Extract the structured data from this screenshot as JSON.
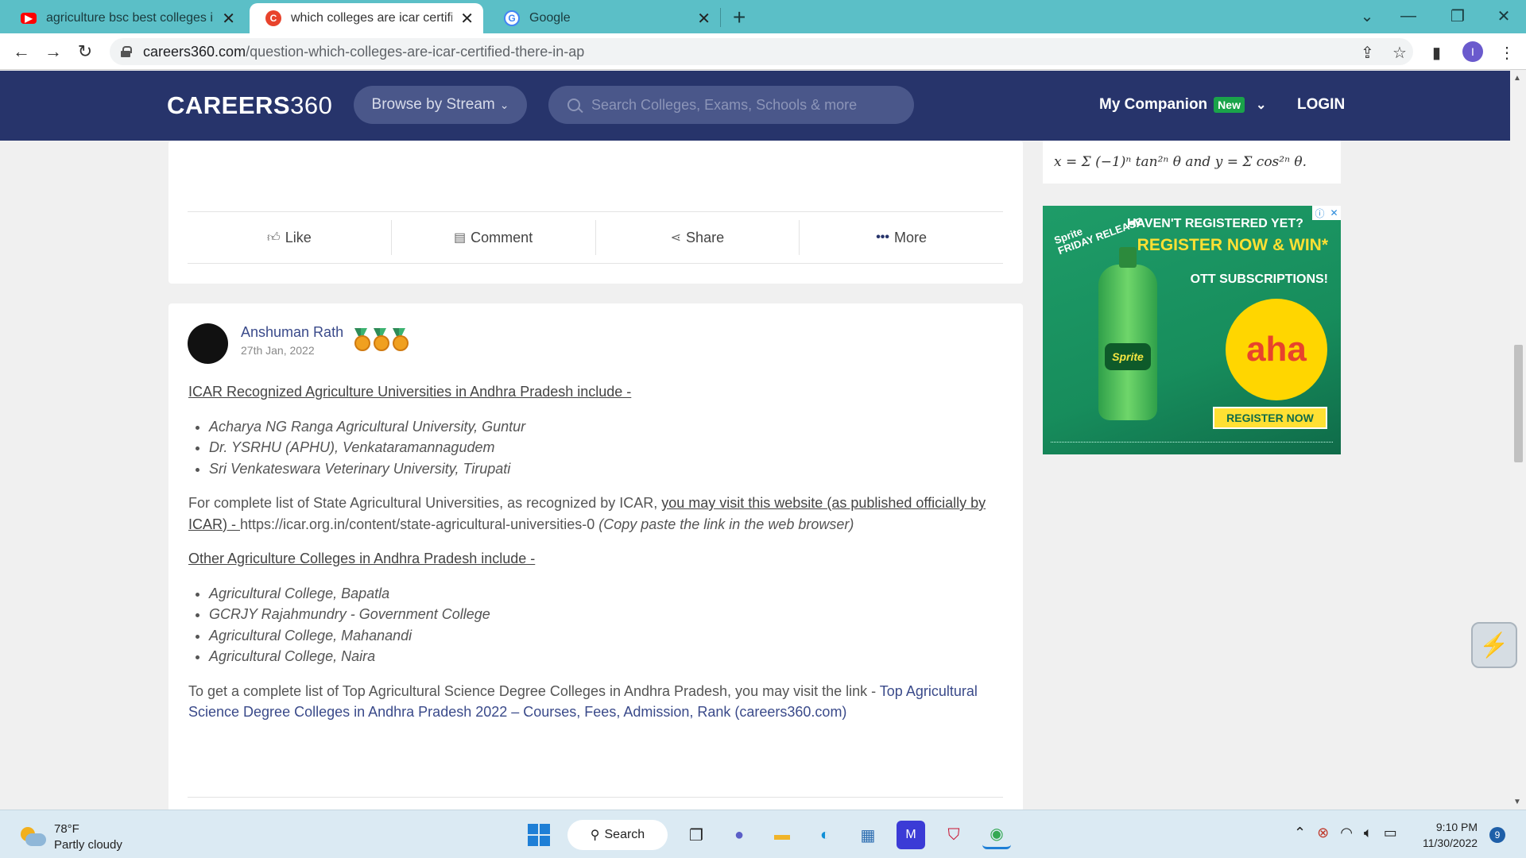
{
  "browser": {
    "tabs": [
      {
        "title": "agriculture bsc best colleges in a",
        "favicon": "youtube-icon",
        "color": "#ff0000"
      },
      {
        "title": "which colleges are icar certified t",
        "favicon": "careers360-icon",
        "color": "#e8432c"
      },
      {
        "title": "Google",
        "favicon": "google-icon",
        "color": "#4285f4"
      }
    ],
    "url_host": "careers360.com",
    "url_path": "/question-which-colleges-are-icar-certified-there-in-ap",
    "profile_initial": "I"
  },
  "site_header": {
    "logo_bold": "CAREERS",
    "logo_light": "360",
    "browse_label": "Browse by Stream",
    "search_placeholder": "Search Colleges, Exams, Schools & more",
    "companion_label": "My Companion",
    "new_badge": "New",
    "login_label": "LOGIN"
  },
  "post_actions": {
    "like": "Like",
    "comment": "Comment",
    "share": "Share",
    "more": "More"
  },
  "answer": {
    "author": "Anshuman Rath",
    "date": "27th Jan, 2022",
    "heading1": "ICAR Recognized Agriculture Universities in Andhra Pradesh include -",
    "list1": [
      "Acharya NG Ranga Agricultural University, Guntur",
      "Dr. YSRHU (APHU), Venkataramannagudem",
      "Sri Venkateswara Veterinary University, Tirupati"
    ],
    "para_prefix": "For complete list of State Agricultural Universities, as recognized by ICAR, ",
    "para_link": "you may visit this website (as published officially by ICAR) - ",
    "para_url": "https://icar.org.in/content/state-agricultural-universities-0",
    "para_note": " (Copy paste the link in the web browser)",
    "heading2": "Other Agriculture Colleges in Andhra Pradesh include -",
    "list2": [
      "Agricultural College, Bapatla",
      "GCRJY Rajahmundry - Government College",
      "Agricultural College, Mahanandi",
      "Agricultural College, Naira"
    ],
    "final_prefix": "To get a complete list of Top Agricultural Science Degree Colleges in Andhra Pradesh, you may visit the link - ",
    "final_link": "Top Agricultural Science Degree Colleges in Andhra Pradesh 2022 – Courses, Fees, Admission, Rank (careers360.com)"
  },
  "sidebar": {
    "formula_text": "x = Σ (−1)ⁿ tan²ⁿ θ and y = Σ cos²ⁿ θ.",
    "ad": {
      "brand": "Sprite",
      "friday": "FRIDAY RELEASE",
      "headline": "HAVEN'T REGISTERED YET?",
      "register": "REGISTER NOW & WIN*",
      "ott": "OTT SUBSCRIPTIONS!",
      "aha": "aha",
      "button": "REGISTER NOW"
    }
  },
  "taskbar": {
    "temperature": "78°F",
    "condition": "Partly cloudy",
    "search_label": "Search",
    "time": "9:10 PM",
    "date": "11/30/2022",
    "notifications": "9"
  },
  "colors": {
    "tabbar": "#5bbfc7",
    "site_header": "#27346b",
    "link": "#3a4a8a",
    "taskbar": "#dbeaf3"
  }
}
